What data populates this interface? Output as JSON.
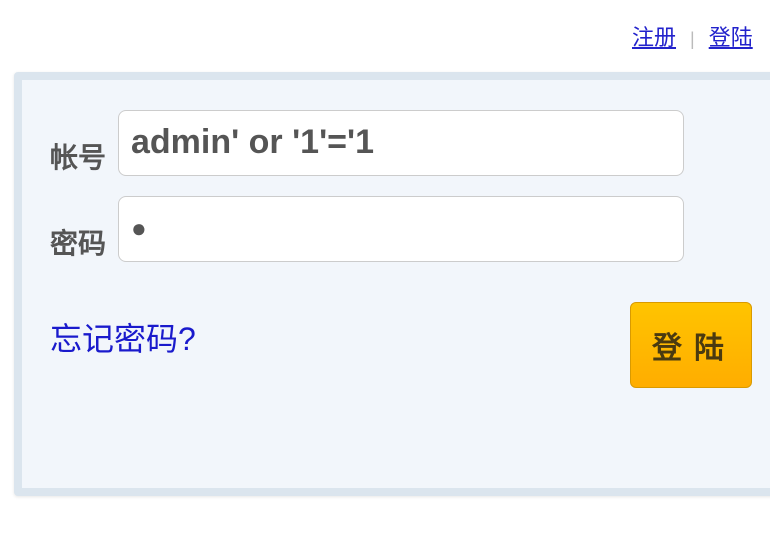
{
  "header": {
    "register": "注册",
    "separator": "|",
    "login": "登陆"
  },
  "form": {
    "account_label": "帐号",
    "account_value": "admin' or '1'='1",
    "password_label": "密码",
    "password_value": "●",
    "forgot": "忘记密码?",
    "submit": "登陆"
  }
}
